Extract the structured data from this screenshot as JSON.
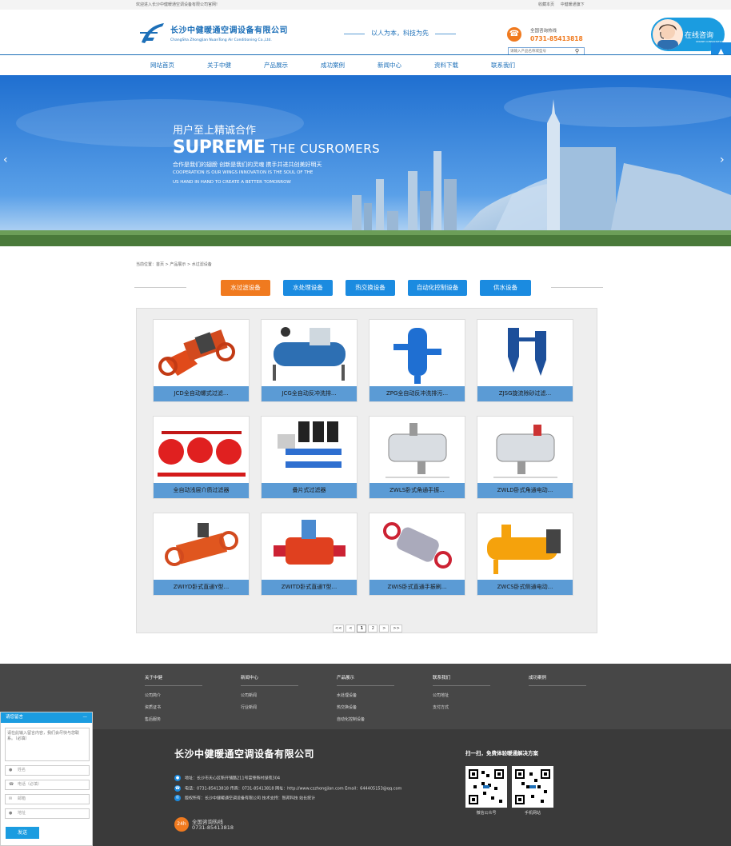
{
  "topbar": {
    "welcome": "欢迎进入长沙中健暖通空调设备有限公司官网!",
    "links": [
      "收藏本页",
      "中健暖通旗下"
    ]
  },
  "header": {
    "company_name": "长沙中健暖通空调设备有限公司",
    "company_name_en": "ChangSha ZhongJian NuanTong Air Conditioning Co.,Ltd.",
    "slogan": "以人为本，科技为先",
    "hotline_label": "全国咨询热线",
    "hotline": "0731-85413818",
    "search_placeholder": "请输入产品名称或型号",
    "consult_label": "在线咨询",
    "consult_sub": "ONLINE CONSULTATION"
  },
  "nav": [
    "网站首页",
    "关于中健",
    "产品展示",
    "成功案例",
    "新闻中心",
    "资料下载",
    "联系我们"
  ],
  "banner": {
    "line1": "用户至上精诚合作",
    "line2_bold": "SUPREME",
    "line2_rest": "THE CUSROMERS",
    "line3": "合作是我们的翅膀  创新是我们的灵魂  携手并进共创美好明天",
    "line4": "COOPERATION IS OUR WINGS INNOVATION IS THE SOUL OF THE",
    "line5": "US HAND IN HAND TO CREATE A BETTER TOMORROW"
  },
  "breadcrumb": "当前位置：首页 > 产品展示 > 水过滤设备",
  "categories": [
    {
      "label": "水过滤设备",
      "color": "#f07a1f"
    },
    {
      "label": "水处理设备",
      "color": "#1b8be0"
    },
    {
      "label": "热交换设备",
      "color": "#1b8be0"
    },
    {
      "label": "自动化控制设备",
      "color": "#1b8be0"
    },
    {
      "label": "供水设备",
      "color": "#1b8be0"
    }
  ],
  "products": [
    "JCD全自动螺式过滤...",
    "JCG全自动反冲洗排...",
    "ZPG全自动反冲洗排污...",
    "ZJSG旋流除砂过滤...",
    "全自动浅层介质过滤器",
    "叠片式过滤器",
    "ZWLS卧式角通手振...",
    "ZWLD卧式角通电动...",
    "ZWIYD卧式直通Y型...",
    "ZWITD卧式直通T型...",
    "ZWIS卧式直通手振刷...",
    "ZWCS卧式侧通电动..."
  ],
  "pager": [
    "<<",
    "<",
    "1",
    "2",
    ">",
    ">>"
  ],
  "footer_nav": [
    {
      "title": "关于中健",
      "links": [
        "公司简介",
        "资质证书",
        "售后服务"
      ]
    },
    {
      "title": "新闻中心",
      "links": [
        "公司新闻",
        "行业新闻"
      ]
    },
    {
      "title": "产品展示",
      "links": [
        "水处理设备",
        "热交换设备",
        "自动化控制设备"
      ]
    },
    {
      "title": "联系我们",
      "links": [
        "公司地址",
        "支付方式"
      ]
    },
    {
      "title": "成功案例",
      "links": []
    }
  ],
  "footer": {
    "name": "长沙中健暖通空调设备有限公司",
    "address": "地址：长沙市天心区新开铺路211号雷锋新村绿苑304",
    "contact": "电话：0731-85413818  传真：0731-85413818  网址：http://www.cszhongjian.com  Email：644405153@qq.com",
    "copyright": "版权所有：长沙中健暖通空调设备有限公司  技术支持：智邦科技  站长统计",
    "hotline_label": "全国咨询热线",
    "hotline": "0731-85413818",
    "phone_badge": "24h",
    "qr_title": "扫一扫，免费体验暖通解决方案",
    "qr_labels": [
      "微信公众号",
      "手机网站"
    ]
  },
  "message_box": {
    "title": "请您留言",
    "textarea_placeholder": "请在此输入留言内容，我们会尽快与您联系。（必填）",
    "fields": [
      "姓名",
      "电话（必填）",
      "邮箱",
      "地址"
    ],
    "send": "发送"
  },
  "colors": {
    "brand_blue": "#1c6fb8",
    "accent_orange": "#f07a1f",
    "caption_blue": "#5b9bd5"
  }
}
